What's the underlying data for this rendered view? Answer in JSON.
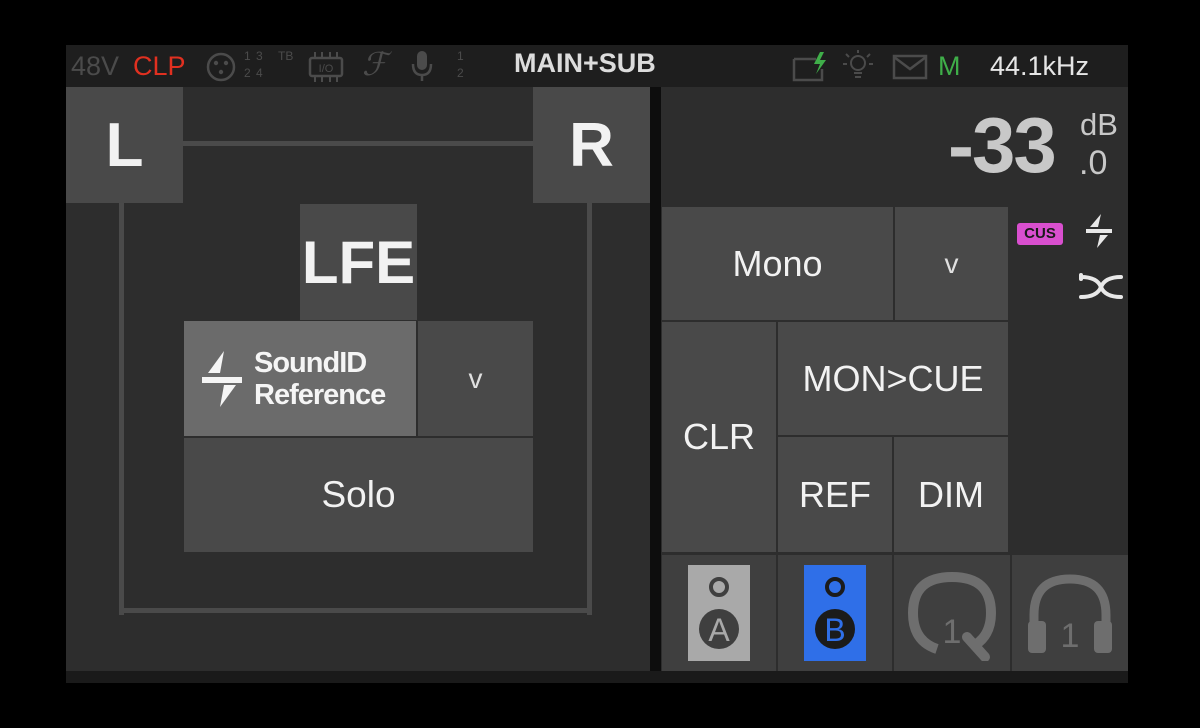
{
  "status_bar": {
    "phantom": "48V",
    "clip": "CLP",
    "input_nums_top": "1 3",
    "input_nums_bottom": "2 4",
    "tb": "TB",
    "mic_nums_top": "1",
    "mic_nums_bottom": "2",
    "mode": "MAIN+SUB",
    "m_indicator": "M",
    "sample_rate": "44.1kHz",
    "colors": {
      "clip": "#e03020",
      "m": "#3fae49",
      "dim": "#4b4b4b"
    }
  },
  "speakers": {
    "left": "L",
    "right": "R",
    "lfe": "LFE"
  },
  "soundid": {
    "line1": "SoundID",
    "line2": "Reference",
    "arrow": "v"
  },
  "solo": "Solo",
  "volume": {
    "value": "-33",
    "decimal": ".0",
    "unit": "dB"
  },
  "controls": {
    "mono": "Mono",
    "mono_arrow": "v",
    "clr": "CLR",
    "mon_cue": "MON>CUE",
    "ref": "REF",
    "dim": "DIM"
  },
  "side": {
    "badge": "CUS",
    "badge_color": "#d94fcf"
  },
  "outputs": {
    "speaker_a": "A",
    "speaker_b": "B",
    "cue_1": "1",
    "headphone_1": "1",
    "speaker_b_color": "#2f6fe8"
  }
}
